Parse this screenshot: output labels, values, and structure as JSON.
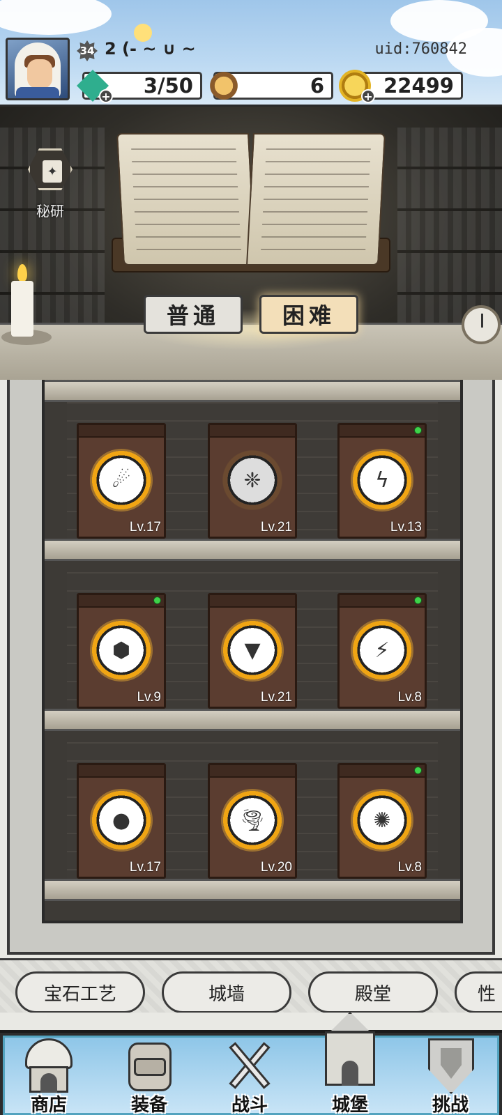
{
  "player": {
    "level": "34",
    "name": "2 (- ~ ∪ ~",
    "uid": "uid:760842"
  },
  "resources": [
    {
      "name": "energy",
      "value": "3/50",
      "icon": "energy-gem-icon",
      "color": "#2fae8e"
    },
    {
      "name": "tickets",
      "value": "6",
      "icon": "treasure-pile-icon",
      "color": "#d8a24a"
    },
    {
      "name": "gold",
      "value": "22499",
      "icon": "gold-coin-icon",
      "color": "#e3b425"
    }
  ],
  "research": {
    "label": "秘研"
  },
  "mode_tabs": [
    {
      "label": "普通",
      "active": false
    },
    {
      "label": "困难",
      "active": true
    }
  ],
  "tomes": [
    {
      "level": "Lv.17",
      "icon": "meteor-icon",
      "symbol": "☄",
      "lit": true,
      "notify": false
    },
    {
      "level": "Lv.21",
      "icon": "crystal-icon",
      "symbol": "❈",
      "lit": false,
      "notify": false
    },
    {
      "level": "Lv.13",
      "icon": "lightning-chain-icon",
      "symbol": "ϟ",
      "lit": true,
      "notify": true
    },
    {
      "level": "Lv.9",
      "icon": "ice-block-icon",
      "symbol": "⬢",
      "lit": true,
      "notify": true
    },
    {
      "level": "Lv.21",
      "icon": "drill-icon",
      "symbol": "▼",
      "lit": true,
      "notify": false
    },
    {
      "level": "Lv.8",
      "icon": "lightning-branch-icon",
      "symbol": "⚡",
      "lit": true,
      "notify": true
    },
    {
      "level": "Lv.17",
      "icon": "bomb-icon",
      "symbol": "●",
      "lit": true,
      "notify": false
    },
    {
      "level": "Lv.20",
      "icon": "tornado-icon",
      "symbol": "🌪",
      "lit": true,
      "notify": false
    },
    {
      "level": "Lv.8",
      "icon": "black-hole-icon",
      "symbol": "✺",
      "lit": true,
      "notify": true
    }
  ],
  "categories": [
    {
      "label": "宝石工艺"
    },
    {
      "label": "城墙"
    },
    {
      "label": "殿堂"
    },
    {
      "label": "性"
    }
  ],
  "nav": [
    {
      "label": "商店",
      "icon": "shop-hut-icon"
    },
    {
      "label": "装备",
      "icon": "backpack-icon"
    },
    {
      "label": "战斗",
      "icon": "crossed-swords-icon"
    },
    {
      "label": "城堡",
      "icon": "castle-icon"
    },
    {
      "label": "挑战",
      "icon": "shield-icon"
    }
  ]
}
